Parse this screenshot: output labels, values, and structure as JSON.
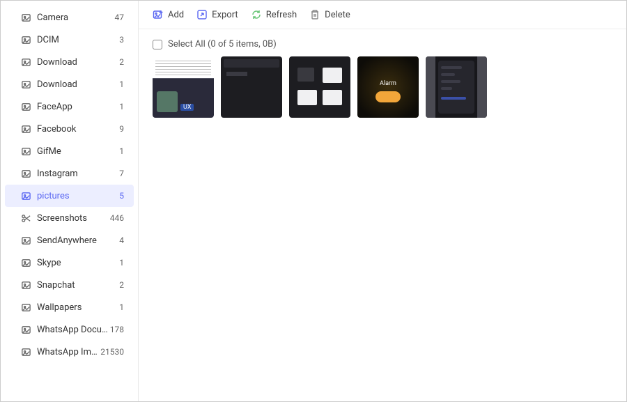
{
  "sidebar": {
    "items": [
      {
        "label": "Camera",
        "count": "47",
        "icon": "image"
      },
      {
        "label": "DCIM",
        "count": "3",
        "icon": "image"
      },
      {
        "label": "Download",
        "count": "2",
        "icon": "image"
      },
      {
        "label": "Download",
        "count": "1",
        "icon": "image"
      },
      {
        "label": "FaceApp",
        "count": "1",
        "icon": "image"
      },
      {
        "label": "Facebook",
        "count": "9",
        "icon": "image"
      },
      {
        "label": "GifMe",
        "count": "1",
        "icon": "image"
      },
      {
        "label": "Instagram",
        "count": "7",
        "icon": "image"
      },
      {
        "label": "pictures",
        "count": "5",
        "icon": "image",
        "selected": true
      },
      {
        "label": "Screenshots",
        "count": "446",
        "icon": "scissors"
      },
      {
        "label": "SendAnywhere",
        "count": "4",
        "icon": "image"
      },
      {
        "label": "Skype",
        "count": "1",
        "icon": "image"
      },
      {
        "label": "Snapchat",
        "count": "2",
        "icon": "image"
      },
      {
        "label": "Wallpapers",
        "count": "1",
        "icon": "image"
      },
      {
        "label": "WhatsApp Documents",
        "count": "178",
        "icon": "image"
      },
      {
        "label": "WhatsApp Images",
        "count": "21530",
        "icon": "image"
      }
    ]
  },
  "toolbar": {
    "add_label": "Add",
    "export_label": "Export",
    "refresh_label": "Refresh",
    "delete_label": "Delete"
  },
  "select_all": {
    "label": "Select All (0 of 5 items, 0B)"
  },
  "thumbs": {
    "alarm_text": "Alarm"
  }
}
